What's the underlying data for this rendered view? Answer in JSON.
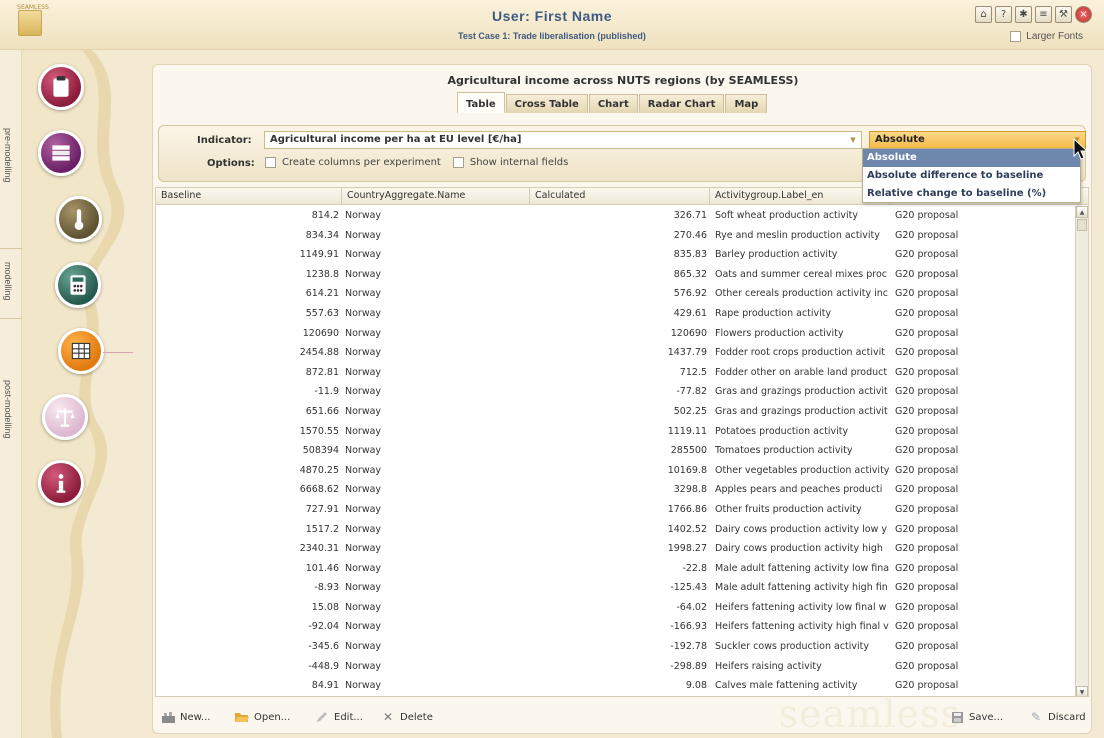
{
  "header": {
    "user_title": "User: First Name",
    "subtitle": "Test Case 1: Trade liberalisation (published)",
    "larger_fonts_label": "Larger Fonts",
    "icons": [
      "home-icon",
      "help-icon",
      "settings-icon",
      "list-icon",
      "tools-icon",
      "close-icon"
    ],
    "logo_text": "SEAMLESS"
  },
  "sidebar": {
    "sections": [
      {
        "label": "pre-modelling"
      },
      {
        "label": "modelling"
      },
      {
        "label": "post-modelling"
      }
    ],
    "items": [
      {
        "icon": "clipboard-icon"
      },
      {
        "icon": "books-icon"
      },
      {
        "icon": "thermometer-icon"
      },
      {
        "icon": "calculator-icon"
      },
      {
        "icon": "table-grid-icon"
      },
      {
        "icon": "scales-icon"
      },
      {
        "icon": "info-icon"
      }
    ]
  },
  "content": {
    "title": "Agricultural income across NUTS regions (by SEAMLESS)",
    "tabs": [
      {
        "label": "Table",
        "active": true
      },
      {
        "label": "Cross Table"
      },
      {
        "label": "Chart"
      },
      {
        "label": "Radar Chart"
      },
      {
        "label": "Map"
      }
    ],
    "indicator_label": "Indicator:",
    "indicator_value": "Agricultural income per ha at EU level [€/ha]",
    "mode_value": "Absolute",
    "mode_options": [
      "Absolute",
      "Absolute difference to baseline",
      "Relative change to baseline (%)"
    ],
    "options_label": "Options:",
    "option_columns": "Create columns per experiment",
    "option_internal": "Show internal fields"
  },
  "table": {
    "columns": [
      "Baseline",
      "CountryAggregate.Name",
      "Calculated",
      "Activitygroup.Label_en",
      ""
    ],
    "rows": [
      [
        "814.2",
        "Norway",
        "326.71",
        "Soft wheat production activity",
        "G20 proposal"
      ],
      [
        "834.34",
        "Norway",
        "270.46",
        "Rye and meslin production activity",
        "G20 proposal"
      ],
      [
        "1149.91",
        "Norway",
        "835.83",
        "Barley production activity",
        "G20 proposal"
      ],
      [
        "1238.8",
        "Norway",
        "865.32",
        "Oats and summer cereal mixes proc",
        "G20 proposal"
      ],
      [
        "614.21",
        "Norway",
        "576.92",
        "Other cereals production activity inc",
        "G20 proposal"
      ],
      [
        "557.63",
        "Norway",
        "429.61",
        "Rape production activity",
        "G20 proposal"
      ],
      [
        "120690",
        "Norway",
        "120690",
        "Flowers production activity",
        "G20 proposal"
      ],
      [
        "2454.88",
        "Norway",
        "1437.79",
        "Fodder root crops production activit",
        "G20 proposal"
      ],
      [
        "872.81",
        "Norway",
        "712.5",
        "Fodder other on arable land product",
        "G20 proposal"
      ],
      [
        "-11.9",
        "Norway",
        "-77.82",
        "Gras and grazings production activit",
        "G20 proposal"
      ],
      [
        "651.66",
        "Norway",
        "502.25",
        "Gras and grazings production activit",
        "G20 proposal"
      ],
      [
        "1570.55",
        "Norway",
        "1119.11",
        "Potatoes production activity",
        "G20 proposal"
      ],
      [
        "508394",
        "Norway",
        "285500",
        "Tomatoes production activity",
        "G20 proposal"
      ],
      [
        "4870.25",
        "Norway",
        "10169.8",
        "Other vegetables production activity",
        "G20 proposal"
      ],
      [
        "6668.62",
        "Norway",
        "3298.8",
        "Apples pears and peaches producti",
        "G20 proposal"
      ],
      [
        "727.91",
        "Norway",
        "1766.86",
        "Other fruits production activity",
        "G20 proposal"
      ],
      [
        "1517.2",
        "Norway",
        "1402.52",
        "Dairy cows production activity low y",
        "G20 proposal"
      ],
      [
        "2340.31",
        "Norway",
        "1998.27",
        "Dairy cows production activity high",
        "G20 proposal"
      ],
      [
        "101.46",
        "Norway",
        "-22.8",
        "Male adult fattening activity low fina",
        "G20 proposal"
      ],
      [
        "-8.93",
        "Norway",
        "-125.43",
        "Male adult fattening activity high fin",
        "G20 proposal"
      ],
      [
        "15.08",
        "Norway",
        "-64.02",
        "Heifers fattening activity low final w",
        "G20 proposal"
      ],
      [
        "-92.04",
        "Norway",
        "-166.93",
        "Heifers fattening activity high final v",
        "G20 proposal"
      ],
      [
        "-345.6",
        "Norway",
        "-192.78",
        "Suckler cows production activity",
        "G20 proposal"
      ],
      [
        "-448.9",
        "Norway",
        "-298.89",
        "Heifers raising activity",
        "G20 proposal"
      ],
      [
        "84.91",
        "Norway",
        "9.08",
        "Calves male fattening activity",
        "G20 proposal"
      ]
    ]
  },
  "toolbar": {
    "new_label": "New...",
    "open_label": "Open...",
    "edit_label": "Edit...",
    "delete_label": "Delete",
    "save_label": "Save...",
    "discard_label": "Discard",
    "watermark": "seamless"
  },
  "colors": {
    "accent_orange": "#f3ba45",
    "selection_blue": "#6d87ad",
    "title_blue": "#3c5a84"
  }
}
